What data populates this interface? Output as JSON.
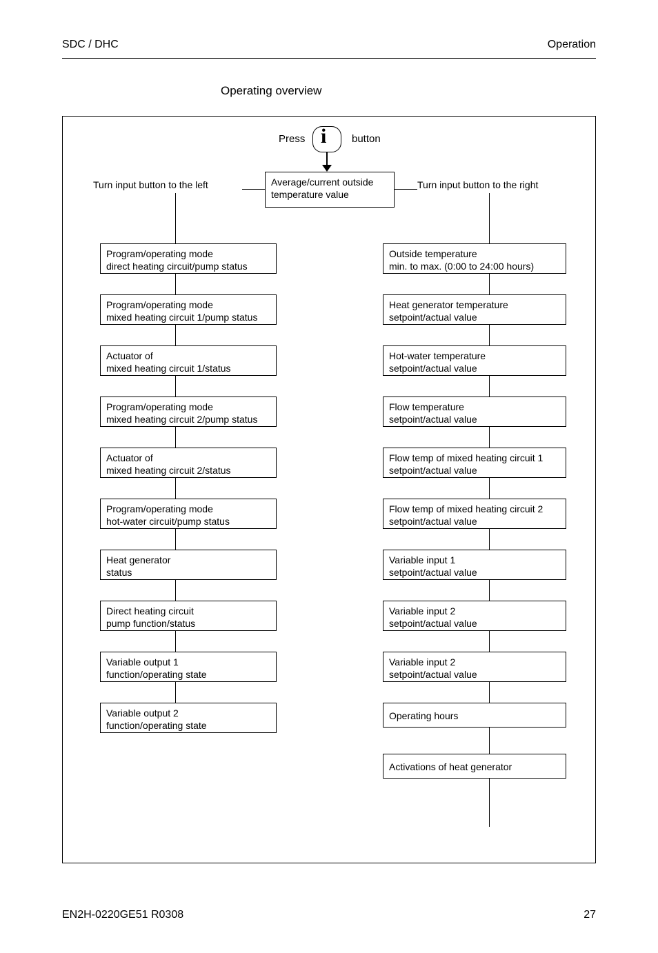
{
  "header": {
    "left": "SDC / DHC",
    "right": "Operation"
  },
  "section_title": "Operating overview",
  "center": {
    "press": "Press",
    "button": "button",
    "box_l1": "Average/current outside",
    "box_l2": "temperature value"
  },
  "top": {
    "left": "Turn input button to the left",
    "right": "Turn input button to the right"
  },
  "left_boxes": [
    {
      "l1": "Program/operating mode",
      "l2": "direct heating circuit/pump status"
    },
    {
      "l1": "Program/operating mode",
      "l2": "mixed heating circuit 1/pump status"
    },
    {
      "l1": "Actuator of",
      "l2": "mixed heating circuit 1/status"
    },
    {
      "l1": "Program/operating mode",
      "l2": "mixed heating circuit 2/pump status"
    },
    {
      "l1": "Actuator of",
      "l2": "mixed heating circuit 2/status"
    },
    {
      "l1": "Program/operating mode",
      "l2": "hot-water circuit/pump status"
    },
    {
      "l1": "Heat generator",
      "l2": "status"
    },
    {
      "l1": "Direct heating circuit",
      "l2": "pump function/status"
    },
    {
      "l1": "Variable output 1",
      "l2": "function/operating state"
    },
    {
      "l1": "Variable output 2",
      "l2": "function/operating state"
    }
  ],
  "right_boxes": [
    {
      "l1": "Outside temperature",
      "l2": "min. to max. (0:00 to 24:00 hours)"
    },
    {
      "l1": "Heat generator temperature",
      "l2": "setpoint/actual value"
    },
    {
      "l1": "Hot-water temperature",
      "l2": "setpoint/actual value"
    },
    {
      "l1": "Flow temperature",
      "l2": "setpoint/actual value"
    },
    {
      "l1": "Flow temp of mixed heating circuit 1",
      "l2": "setpoint/actual value"
    },
    {
      "l1": "Flow temp of mixed heating circuit 2",
      "l2": "setpoint/actual value"
    },
    {
      "l1": "Variable input 1",
      "l2": "setpoint/actual value"
    },
    {
      "l1": "Variable input 2",
      "l2": "setpoint/actual value"
    },
    {
      "l1": "Variable input 2",
      "l2": "setpoint/actual value"
    },
    {
      "single": "Operating hours"
    },
    {
      "single": "Activations of heat generator"
    }
  ],
  "footer": {
    "left": "EN2H-0220GE51 R0308",
    "right": "27"
  }
}
